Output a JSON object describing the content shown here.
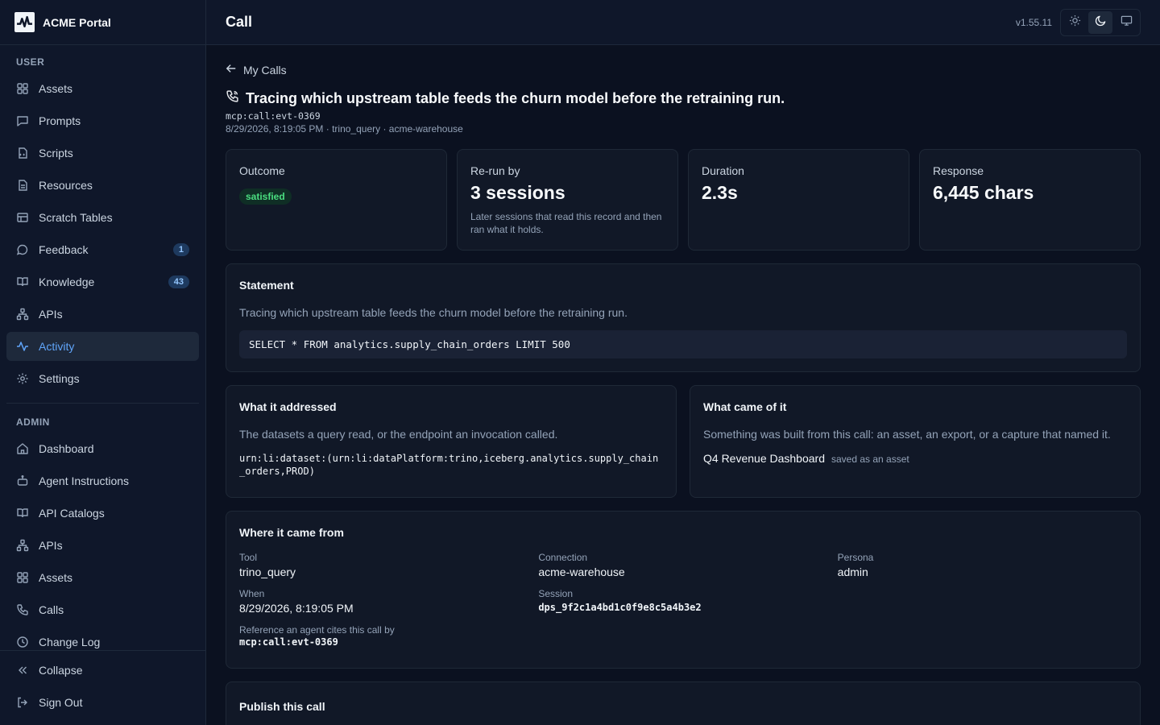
{
  "brand": {
    "name": "ACME Portal"
  },
  "sidebar": {
    "user_section": "USER",
    "user_items": [
      {
        "label": "Assets",
        "icon": "grid-icon"
      },
      {
        "label": "Prompts",
        "icon": "chat-icon"
      },
      {
        "label": "Scripts",
        "icon": "script-icon"
      },
      {
        "label": "Resources",
        "icon": "file-icon"
      },
      {
        "label": "Scratch Tables",
        "icon": "table-icon"
      },
      {
        "label": "Feedback",
        "icon": "message-icon",
        "badge": "1"
      },
      {
        "label": "Knowledge",
        "icon": "book-icon",
        "badge": "43"
      },
      {
        "label": "APIs",
        "icon": "network-icon"
      },
      {
        "label": "Activity",
        "icon": "activity-icon",
        "active": true
      },
      {
        "label": "Settings",
        "icon": "gear-icon"
      }
    ],
    "admin_section": "ADMIN",
    "admin_items": [
      {
        "label": "Dashboard",
        "icon": "home-icon"
      },
      {
        "label": "Agent Instructions",
        "icon": "robot-icon"
      },
      {
        "label": "API Catalogs",
        "icon": "book-icon"
      },
      {
        "label": "APIs",
        "icon": "network-icon"
      },
      {
        "label": "Assets",
        "icon": "grid-icon"
      },
      {
        "label": "Calls",
        "icon": "phone-icon"
      },
      {
        "label": "Change Log",
        "icon": "clock-icon"
      }
    ],
    "collapse": "Collapse",
    "sign_out": "Sign Out"
  },
  "topbar": {
    "title": "Call",
    "version": "v1.55.11"
  },
  "page": {
    "back_label": "My Calls",
    "title": "Tracing which upstream table feeds the churn model before the retraining run.",
    "call_id": "mcp:call:evt-0369",
    "meta": "8/29/2026, 8:19:05 PM · trino_query · acme-warehouse"
  },
  "stats": {
    "outcome_label": "Outcome",
    "outcome_value": "satisfied",
    "rerun_label": "Re-run by",
    "rerun_value": "3 sessions",
    "rerun_note": "Later sessions that read this record and then ran what it holds.",
    "duration_label": "Duration",
    "duration_value": "2.3s",
    "response_label": "Response",
    "response_value": "6,445 chars"
  },
  "statement": {
    "title": "Statement",
    "text": "Tracing which upstream table feeds the churn model before the retraining run.",
    "sql": "SELECT * FROM analytics.supply_chain_orders LIMIT 500"
  },
  "addressed": {
    "title": "What it addressed",
    "text": "The datasets a query read, or the endpoint an invocation called.",
    "urn": "urn:li:dataset:(urn:li:dataPlatform:trino,iceberg.analytics.supply_chain_orders,PROD)"
  },
  "outcome_card": {
    "title": "What came of it",
    "text": "Something was built from this call: an asset, an export, or a capture that named it.",
    "item_name": "Q4 Revenue Dashboard",
    "item_note": "saved as an asset"
  },
  "origin": {
    "title": "Where it came from",
    "tool_label": "Tool",
    "tool_value": "trino_query",
    "connection_label": "Connection",
    "connection_value": "acme-warehouse",
    "persona_label": "Persona",
    "persona_value": "admin",
    "when_label": "When",
    "when_value": "8/29/2026, 8:19:05 PM",
    "session_label": "Session",
    "session_value": "dps_9f2c1a4bd1c0f9e8c5a4b3e2",
    "reference_label": "Reference an agent cites this call by",
    "reference_value": "mcp:call:evt-0369"
  },
  "publish": {
    "title": "Publish this call"
  }
}
